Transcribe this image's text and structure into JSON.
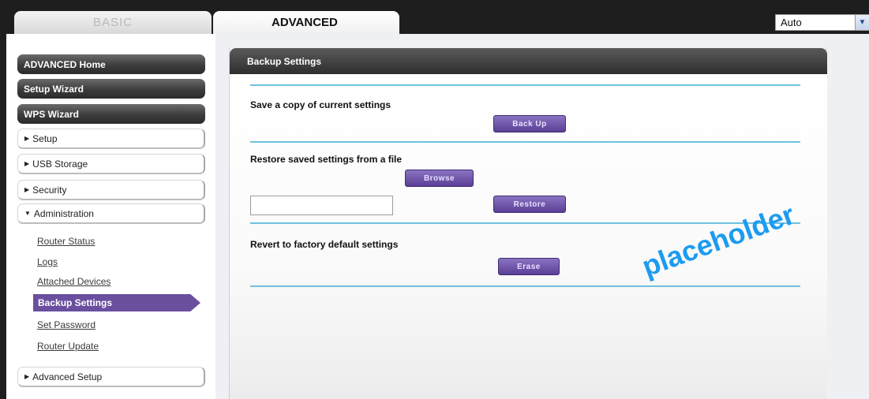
{
  "tabs": {
    "basic": "BASIC",
    "advanced": "ADVANCED"
  },
  "language_select": {
    "value": "Auto"
  },
  "sidebar": {
    "dark_buttons": [
      "ADVANCED Home",
      "Setup Wizard",
      "WPS Wizard"
    ],
    "sections": {
      "setup": "Setup",
      "usb_storage": "USB Storage",
      "security": "Security",
      "administration": "Administration",
      "advanced_setup": "Advanced Setup"
    },
    "admin_items": [
      "Router Status",
      "Logs",
      "Attached Devices",
      "Backup Settings",
      "Set Password",
      "Router Update"
    ],
    "active_item": "Backup Settings"
  },
  "panel": {
    "title": "Backup Settings",
    "save_label": "Save a copy of current settings",
    "backup_button": "Back Up",
    "restore_label": "Restore saved settings from a file",
    "browse_button": "Browse",
    "restore_button": "Restore",
    "revert_label": "Revert to factory default settings",
    "erase_button": "Erase",
    "file_input_value": ""
  },
  "watermark": "placeholder",
  "colors": {
    "accent_purple": "#6a4f9f",
    "rule_blue": "#6fc1df",
    "watermark_blue": "#1d9bf0"
  }
}
